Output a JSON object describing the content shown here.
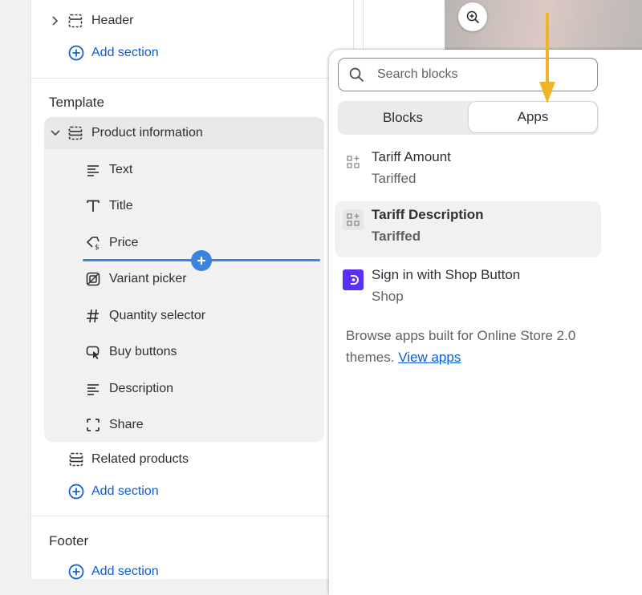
{
  "sidebar": {
    "header_item": "Header",
    "add_section_1": "Add section",
    "template_title": "Template",
    "product_info": "Product information",
    "blocks": [
      {
        "label": "Text",
        "icon": "text-lines-icon"
      },
      {
        "label": "Title",
        "icon": "title-t-icon"
      },
      {
        "label": "Price",
        "icon": "price-tag-icon"
      },
      {
        "label": "Variant picker",
        "icon": "variant-picker-icon"
      },
      {
        "label": "Quantity selector",
        "icon": "hash-icon"
      },
      {
        "label": "Buy buttons",
        "icon": "cursor-click-icon"
      },
      {
        "label": "Description",
        "icon": "text-lines-icon"
      },
      {
        "label": "Share",
        "icon": "share-frame-icon"
      }
    ],
    "related_products": "Related products",
    "add_section_2": "Add section",
    "footer_title": "Footer",
    "add_section_3": "Add section"
  },
  "popover": {
    "search_placeholder": "Search blocks",
    "tabs": [
      {
        "label": "Blocks",
        "active": false
      },
      {
        "label": "Apps",
        "active": true
      }
    ],
    "apps": [
      {
        "title": "Tariff Amount",
        "subtitle": "Tariffed",
        "icon": "app-block-icon",
        "hovered": false
      },
      {
        "title": "Tariff Description",
        "subtitle": "Tariffed",
        "icon": "app-block-icon",
        "hovered": true
      },
      {
        "title": "Sign in with Shop Button",
        "subtitle": "Shop",
        "icon": "shop-logo-icon",
        "hovered": false
      }
    ],
    "browse_text": "Browse apps built for Online Store 2.0 themes.",
    "browse_link": "View apps"
  },
  "colors": {
    "accent_blue": "#0c5bd9",
    "insert_blue": "#3b83e0",
    "arrow_yellow": "#f0b429",
    "shop_purple": "#5a31f4"
  }
}
